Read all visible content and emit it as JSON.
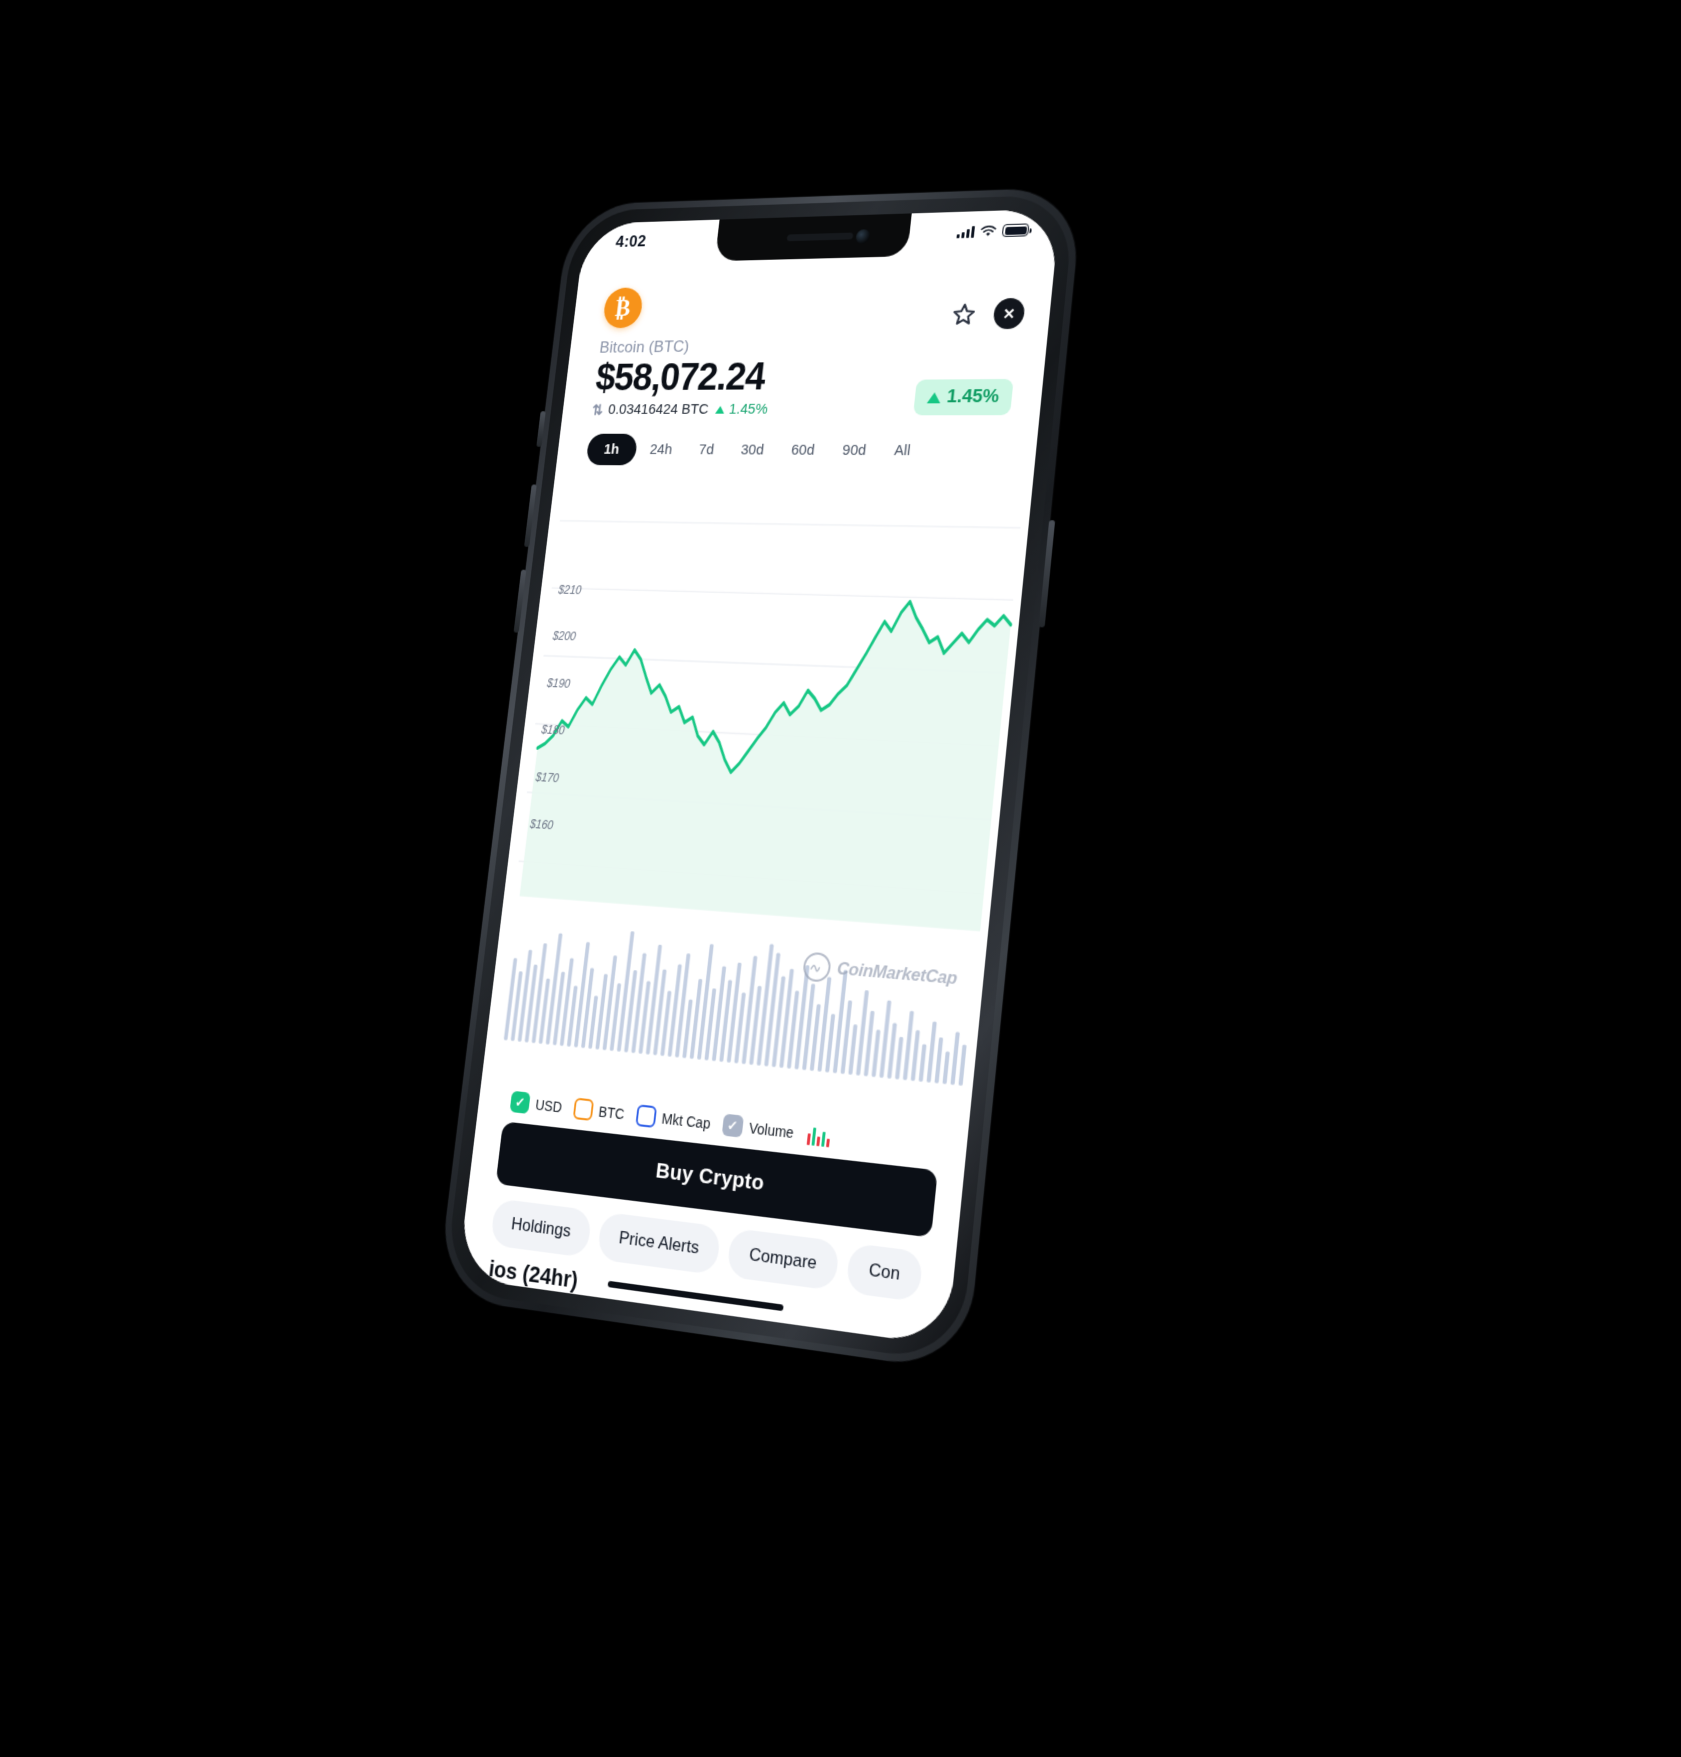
{
  "status_bar": {
    "time": "4:02",
    "icons": [
      "cellular-signal-icon",
      "wifi-icon",
      "battery-icon"
    ]
  },
  "top_bar": {
    "coin_symbol_glyph": "₿",
    "coin_logo_color": "#f7931a",
    "favorite_icon": "star-icon",
    "close_icon": "close-icon",
    "close_glyph": "✕"
  },
  "coin": {
    "name": "Bitcoin (BTC)",
    "price": "$58,072.24",
    "swap_icon_glyph": "⇅",
    "btc_amount": "0.03416424 BTC",
    "sub_change": "1.45%",
    "badge_change": "1.45%",
    "change_direction": "up",
    "positive_color": "#16c784",
    "badge_bg": "#cdf7e4",
    "badge_text_color": "#0f9d63"
  },
  "ranges": {
    "selected": "1h",
    "items": [
      "1h",
      "24h",
      "7d",
      "30d",
      "60d",
      "90d",
      "All"
    ]
  },
  "watermark": {
    "text": "CoinMarketCap",
    "mark": "m"
  },
  "legend": [
    {
      "label": "USD",
      "checked": true,
      "style": "on-green",
      "color": "#16c784"
    },
    {
      "label": "BTC",
      "checked": false,
      "style": "off-orange",
      "color": "#f7931a"
    },
    {
      "label": "Mkt Cap",
      "checked": false,
      "style": "off-blue",
      "color": "#2f5fe8"
    },
    {
      "label": "Volume",
      "checked": true,
      "style": "on-grey",
      "color": "#a9b3c6"
    }
  ],
  "candle_toggle_icon": "candlestick-icon",
  "cta": {
    "label": "Buy Crypto"
  },
  "chips": [
    "Holdings",
    "Price Alerts",
    "Compare",
    "Con"
  ],
  "bottom_partial_text": "ios (24hr)",
  "chart_data": {
    "type": "line",
    "title": "",
    "xlabel": "",
    "ylabel": "",
    "ylim": [
      155,
      215
    ],
    "grid": true,
    "y_ticks": [
      210,
      200,
      190,
      180,
      170,
      160
    ],
    "y_tick_labels": [
      "$210",
      "$200",
      "$190",
      "$180",
      "$170",
      "$160"
    ],
    "line_color": "#16c784",
    "fill_color": "#e8f8f1",
    "series": [
      {
        "name": "USD price",
        "values": [
          176.5,
          177.2,
          178.4,
          180.6,
          179.8,
          182.3,
          184.1,
          183.2,
          186.0,
          188.4,
          190.2,
          189.1,
          191.3,
          190.0,
          187.5,
          185.2,
          186.4,
          184.8,
          182.6,
          183.4,
          181.2,
          182.0,
          179.4,
          178.2,
          180.1,
          178.6,
          176.2,
          174.5,
          175.8,
          177.6,
          179.4,
          181.0,
          183.2,
          184.6,
          183.0,
          184.2,
          186.5,
          185.4,
          183.8,
          184.6,
          186.2,
          187.4,
          189.6,
          191.8,
          194.2,
          196.5,
          195.2,
          197.8,
          199.4,
          197.2,
          195.6,
          193.8,
          194.6,
          192.4,
          193.8,
          195.2,
          194.0,
          195.8,
          197.2,
          196.4,
          197.8,
          196.6
        ]
      }
    ],
    "volume": {
      "name": "Volume",
      "color": "#c4cfe2",
      "values": [
        52,
        44,
        58,
        49,
        63,
        41,
        70,
        46,
        55,
        38,
        66,
        50,
        33,
        47,
        59,
        42,
        75,
        51,
        62,
        45,
        68,
        53,
        40,
        57,
        64,
        36,
        49,
        71,
        44,
        58,
        50,
        61,
        43,
        66,
        48,
        74,
        69,
        55,
        60,
        47,
        63,
        52,
        40,
        57,
        35,
        62,
        44,
        30,
        51,
        39,
        28,
        46,
        33,
        25,
        41,
        30,
        22,
        36,
        27,
        19,
        31,
        24
      ]
    }
  }
}
